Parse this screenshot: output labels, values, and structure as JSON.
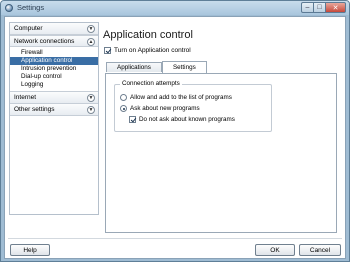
{
  "window": {
    "title": "Settings"
  },
  "sidebar": {
    "categories": [
      {
        "label": "Computer",
        "expanded": false,
        "items": []
      },
      {
        "label": "Network connections",
        "expanded": true,
        "items": [
          {
            "label": "Firewall",
            "selected": false
          },
          {
            "label": "Application control",
            "selected": true
          },
          {
            "label": "Intrusion prevention",
            "selected": false
          },
          {
            "label": "Dial-up control",
            "selected": false
          },
          {
            "label": "Logging",
            "selected": false
          }
        ]
      },
      {
        "label": "Internet",
        "expanded": false,
        "items": []
      },
      {
        "label": "Other settings",
        "expanded": false,
        "items": []
      }
    ]
  },
  "main": {
    "title": "Application control",
    "turn_on": {
      "label": "Turn on Application control",
      "checked": true
    },
    "tabs": [
      {
        "label": "Applications",
        "active": false
      },
      {
        "label": "Settings",
        "active": true
      }
    ],
    "connection_attempts": {
      "legend": "Connection attempts",
      "options": [
        {
          "label": "Allow and add to the list of programs",
          "selected": false
        },
        {
          "label": "Ask about new programs",
          "selected": true
        }
      ],
      "do_not_ask": {
        "label": "Do not ask about known programs",
        "checked": true
      }
    }
  },
  "footer": {
    "help_label": "Help",
    "ok_label": "OK",
    "cancel_label": "Cancel"
  },
  "icons": {
    "expand": "chevron-down-icon",
    "collapse": "chevron-up-icon",
    "close": "close-icon"
  },
  "colors": {
    "selection": "#3a6ea5",
    "titlebar": "#a9c6dd"
  }
}
